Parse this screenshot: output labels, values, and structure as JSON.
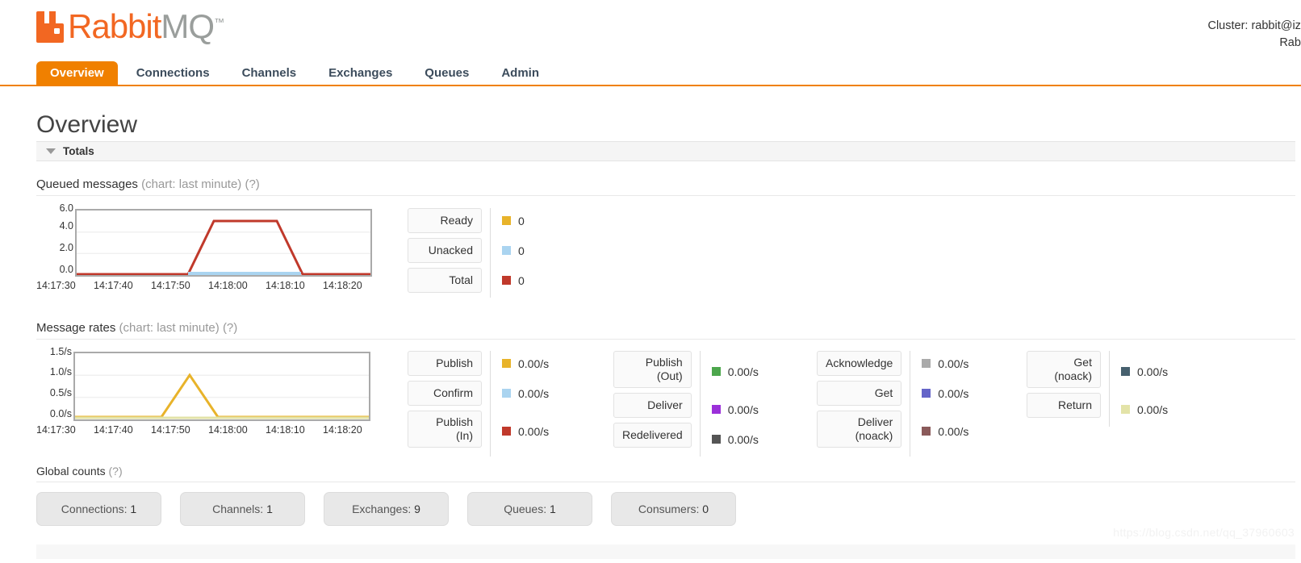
{
  "brand": {
    "rabbit": "Rabbit",
    "mq": "MQ",
    "tm": "™",
    "logo_icon": "rabbitmq-logo-icon"
  },
  "cluster": {
    "line1": "Cluster: rabbit@izo",
    "line2": "Rabb"
  },
  "nav": {
    "items": [
      {
        "label": "Overview",
        "active": true
      },
      {
        "label": "Connections",
        "active": false
      },
      {
        "label": "Channels",
        "active": false
      },
      {
        "label": "Exchanges",
        "active": false
      },
      {
        "label": "Queues",
        "active": false
      },
      {
        "label": "Admin",
        "active": false
      }
    ]
  },
  "page": {
    "title": "Overview"
  },
  "totals": {
    "label": "Totals"
  },
  "queued": {
    "title": "Queued messages",
    "subtitle": " (chart: last minute) ",
    "help": "(?)",
    "legend": [
      {
        "label": "Ready",
        "value": "0",
        "color": "#e8b32a"
      },
      {
        "label": "Unacked",
        "value": "0",
        "color": "#aad4f0"
      },
      {
        "label": "Total",
        "value": "0",
        "color": "#c0392b"
      }
    ]
  },
  "rates": {
    "title": "Message rates",
    "subtitle": " (chart: last minute) ",
    "help": "(?)",
    "columns": [
      {
        "rows": [
          {
            "label": "Publish",
            "label2": "",
            "value": "0.00/s",
            "color": "#e8b32a"
          },
          {
            "label": "Confirm",
            "label2": "",
            "value": "0.00/s",
            "color": "#aad4f0"
          },
          {
            "label": "Publish",
            "label2": "(In)",
            "value": "0.00/s",
            "color": "#c0392b"
          }
        ]
      },
      {
        "rows": [
          {
            "label": "Publish",
            "label2": "(Out)",
            "value": "0.00/s",
            "color": "#4ca64c"
          },
          {
            "label": "Deliver",
            "label2": "",
            "value": "0.00/s",
            "color": "#9b30d9"
          },
          {
            "label": "Redelivered",
            "label2": "",
            "value": "0.00/s",
            "color": "#555555"
          }
        ]
      },
      {
        "rows": [
          {
            "label": "Acknowledge",
            "label2": "",
            "value": "0.00/s",
            "color": "#aaaaaa"
          },
          {
            "label": "Get",
            "label2": "",
            "value": "0.00/s",
            "color": "#6464c8"
          },
          {
            "label": "Deliver",
            "label2": "(noack)",
            "value": "0.00/s",
            "color": "#8a5a5a"
          }
        ]
      },
      {
        "rows": [
          {
            "label": "Get",
            "label2": "(noack)",
            "value": "0.00/s",
            "color": "#46606e"
          },
          {
            "label": "Return",
            "label2": "",
            "value": "0.00/s",
            "color": "#e3e3a8"
          }
        ]
      }
    ]
  },
  "global_counts": {
    "title": "Global counts",
    "help": "(?)",
    "items": [
      {
        "label": "Connections:",
        "value": "1"
      },
      {
        "label": "Channels:",
        "value": "1"
      },
      {
        "label": "Exchanges:",
        "value": "9"
      },
      {
        "label": "Queues:",
        "value": "1"
      },
      {
        "label": "Consumers:",
        "value": "0"
      }
    ]
  },
  "watermark": "https://blog.csdn.net/qq_37960603",
  "chart_data": [
    {
      "id": "queued-messages",
      "type": "line",
      "title": "Queued messages",
      "xlabel": "",
      "ylabel": "",
      "ylim": [
        0,
        6
      ],
      "yticks": [
        "0.0",
        "2.0",
        "4.0",
        "6.0"
      ],
      "xticks": [
        "14:17:30",
        "14:17:40",
        "14:17:50",
        "14:18:00",
        "14:18:10",
        "14:18:20"
      ],
      "xlim": [
        "14:17:27",
        "14:18:25"
      ],
      "grid": true,
      "legend_position": "right",
      "series": [
        {
          "name": "Total",
          "color": "#c0392b",
          "x": [
            "14:17:27",
            "14:17:44",
            "14:17:48",
            "14:18:05",
            "14:18:09",
            "14:18:25"
          ],
          "y": [
            0,
            0,
            5,
            5,
            0,
            0
          ]
        },
        {
          "name": "Unacked",
          "color": "#aad4f0",
          "x": [
            "14:17:44",
            "14:18:08"
          ],
          "y": [
            0.1,
            0.1
          ]
        },
        {
          "name": "Ready",
          "color": "#e8b32a",
          "x": [],
          "y": []
        }
      ]
    },
    {
      "id": "message-rates",
      "type": "line",
      "title": "Message rates",
      "xlabel": "",
      "ylabel": "",
      "ylim": [
        0,
        1.5
      ],
      "yticks": [
        "0.0/s",
        "0.5/s",
        "1.0/s",
        "1.5/s"
      ],
      "xticks": [
        "14:17:30",
        "14:17:40",
        "14:17:50",
        "14:18:00",
        "14:18:10",
        "14:18:20"
      ],
      "xlim": [
        "14:17:27",
        "14:18:25"
      ],
      "grid": true,
      "legend_position": "right",
      "series": [
        {
          "name": "Publish",
          "color": "#e8b32a",
          "x": [
            "14:17:27",
            "14:17:43",
            "14:17:47",
            "14:17:51",
            "14:18:25"
          ],
          "y": [
            0.02,
            0.02,
            1.0,
            0.02,
            0.02
          ]
        }
      ]
    }
  ]
}
